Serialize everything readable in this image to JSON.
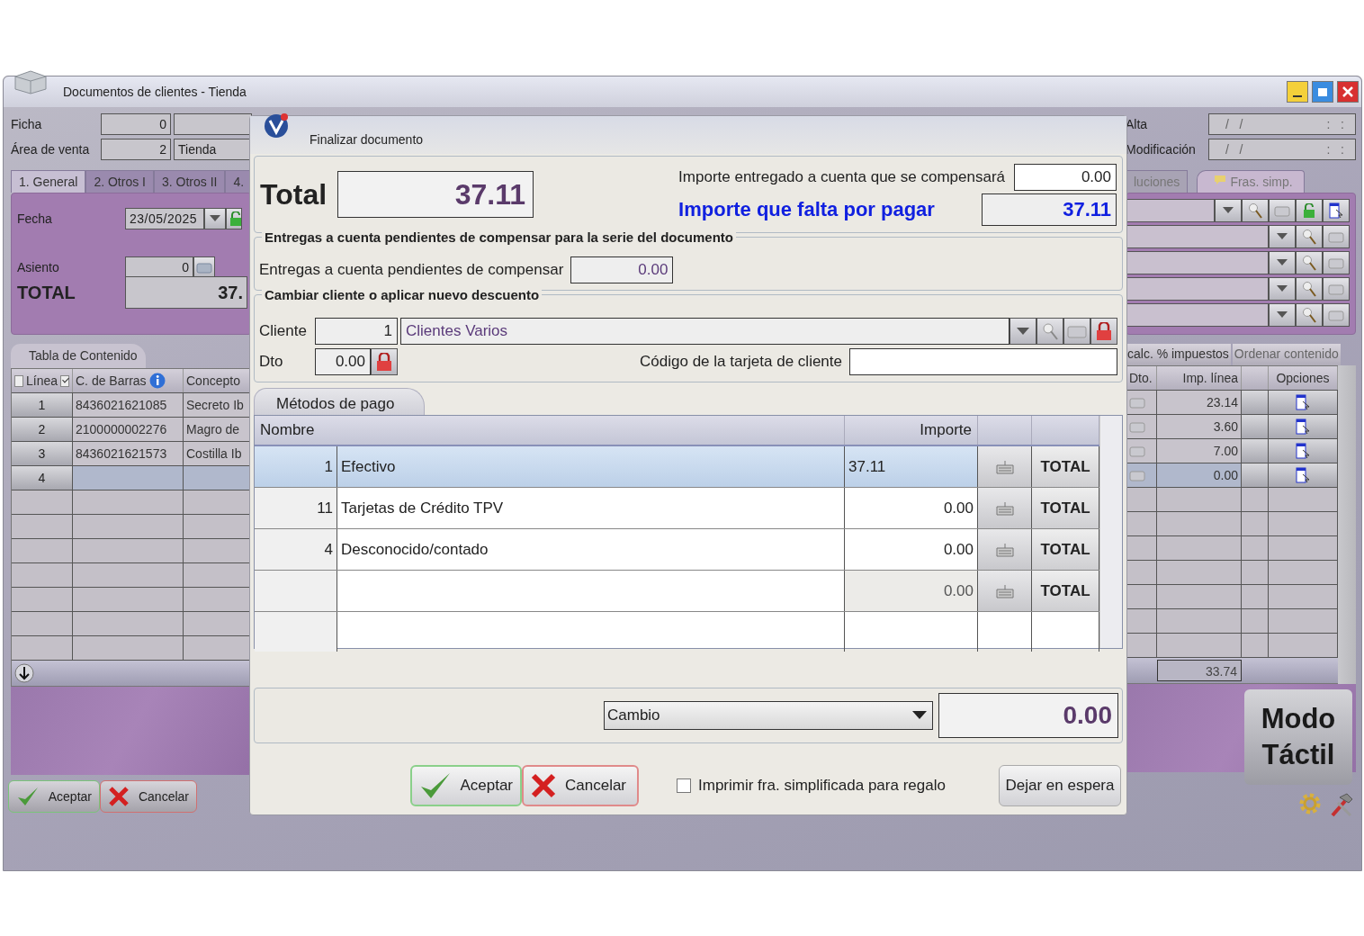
{
  "window": {
    "title": "Documentos de clientes - Tienda"
  },
  "header_left": {
    "ficha_label": "Ficha",
    "ficha_value": "0",
    "area_label": "Área de venta",
    "area_code": "2",
    "area_name": "Tienda"
  },
  "header_right": [
    {
      "label": "Alta",
      "date": "/   /",
      "time": ":   :"
    },
    {
      "label": "Modificación",
      "date": "/   /",
      "time": ":   :"
    }
  ],
  "tabs_left": [
    {
      "label": "1. General",
      "selected": true
    },
    {
      "label": "2. Otros I",
      "selected": false
    },
    {
      "label": "3. Otros II",
      "selected": false
    },
    {
      "label": "4.",
      "selected": false
    }
  ],
  "tabs_right": [
    {
      "label": "luciones",
      "selected": false
    },
    {
      "label": "Fras. simp.",
      "selected": false
    }
  ],
  "general": {
    "fecha_label": "Fecha",
    "fecha": "23/05/2025",
    "asiento_label": "Asiento",
    "asiento": "0",
    "total_label": "TOTAL",
    "total": "37."
  },
  "right_combos": [
    {
      "kind": "full"
    },
    {
      "kind": "basic"
    },
    {
      "kind": "basic"
    },
    {
      "kind": "basic"
    },
    {
      "kind": "basic"
    }
  ],
  "contents": {
    "tab": "Tabla de Contenido",
    "buttons": [
      "calc. % impuestos",
      "Ordenar contenido"
    ],
    "columns": {
      "line": "Línea",
      "barcode": "C. de Barras",
      "concept": "Concepto",
      "dto": "Dto.",
      "imp": "Imp. línea",
      "options": "Opciones"
    },
    "line_checked": false,
    "barcode_checked": true,
    "rows": [
      {
        "line": "1",
        "barcode": "8436021621085",
        "concept": "Secreto Ib",
        "imp": "23.14",
        "selected": false
      },
      {
        "line": "2",
        "barcode": "2100000002276",
        "concept": "Magro de",
        "imp": "3.60",
        "selected": false
      },
      {
        "line": "3",
        "barcode": "8436021621573",
        "concept": "Costilla Ib",
        "imp": "7.00",
        "selected": false
      },
      {
        "line": "4",
        "imp": "0.00",
        "selected": true
      }
    ],
    "footer_total": "33.74"
  },
  "form_buttons": [
    {
      "label": "Aceptar",
      "kind": "ok"
    },
    {
      "label": "Cancelar",
      "kind": "cancel"
    }
  ],
  "touch_button": "Modo Táctil",
  "dialog": {
    "title": "Finalizar documento",
    "total_label": "Total",
    "total": "37.11",
    "entregado_label": "Importe entregado a cuenta que se compensará",
    "entregado": "0.00",
    "falta_label": "Importe que falta por pagar",
    "falta": "37.11",
    "pendientes": {
      "legend": "Entregas a cuenta pendientes de compensar para la serie del documento",
      "label": "Entregas a cuenta pendientes de compensar",
      "value": "0.00"
    },
    "cliente": {
      "legend": "Cambiar cliente o aplicar nuevo descuento",
      "label": "Cliente",
      "code": "1",
      "name": "Clientes Varios",
      "dto_label": "Dto",
      "dto": "0.00",
      "card_label": "Código de la tarjeta de cliente"
    },
    "payments": {
      "tab": "Métodos de pago",
      "columns": [
        "Nombre",
        "Importe"
      ],
      "rows": [
        {
          "code": "1",
          "name": "Efectivo",
          "amount": "37.11",
          "button": "TOTAL",
          "selected": true
        },
        {
          "code": "11",
          "name": "Tarjetas de Crédito TPV",
          "amount": "0.00",
          "button": "TOTAL",
          "selected": false
        },
        {
          "code": "4",
          "name": "Desconocido/contado",
          "amount": "0.00",
          "button": "TOTAL",
          "selected": false
        },
        {
          "amount": "0.00",
          "button": "TOTAL",
          "selected": false
        }
      ]
    },
    "change": {
      "select": "Cambio",
      "value": "0.00"
    },
    "buttons": {
      "ok": "Aceptar",
      "cancel": "Cancelar",
      "gift_label": "Imprimir fra. simplificada para regalo",
      "gift_checked": false,
      "hold": "Dejar en espera"
    }
  }
}
